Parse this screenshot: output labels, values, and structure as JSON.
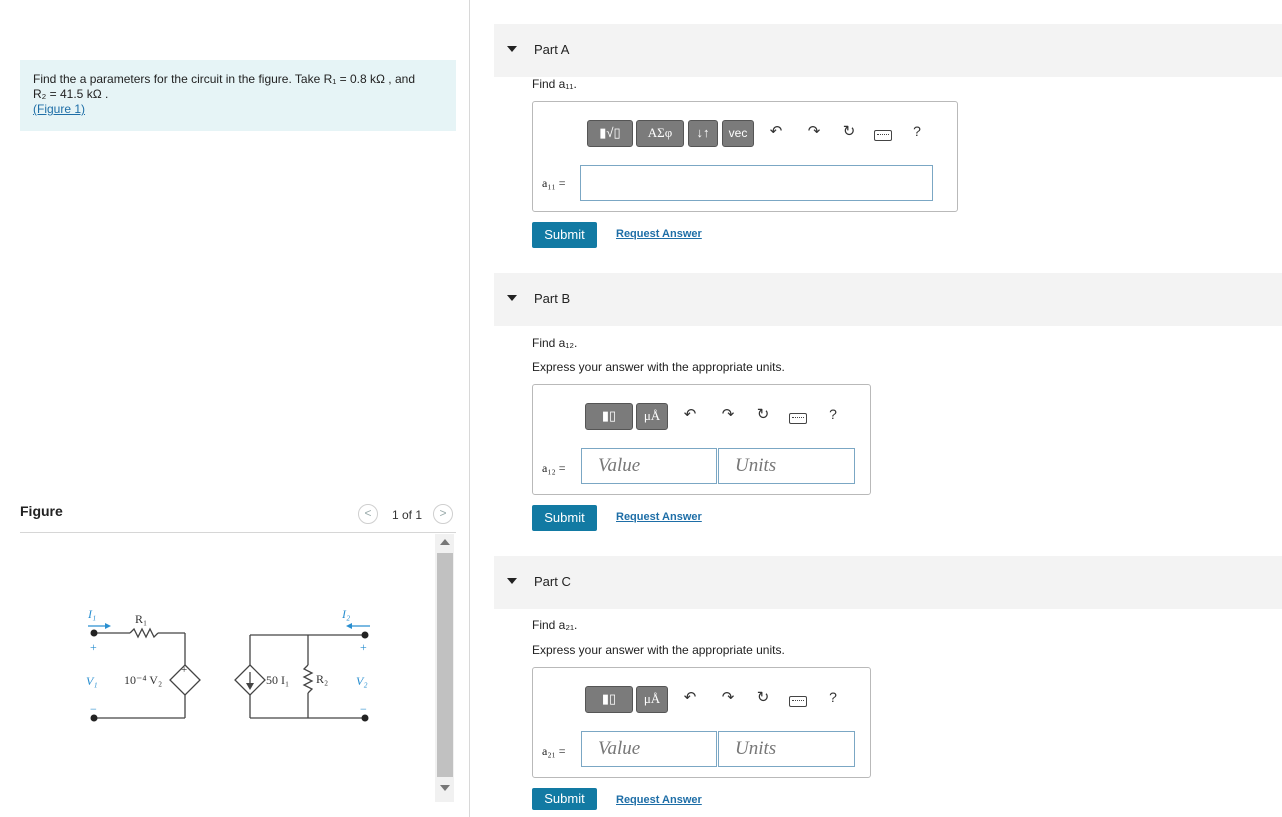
{
  "problem": {
    "line1": "Find the a parameters for the circuit in the figure. Take R₁ = 0.8 kΩ , and",
    "line2": "R₂ = 41.5 kΩ .",
    "figure_link": "(Figure 1)"
  },
  "figure": {
    "label": "Figure",
    "pager": "1 of 1",
    "circuit": {
      "i1": "I₁",
      "r1": "R₁",
      "i2": "I₂",
      "r2": "R₂",
      "v1": "V₁",
      "v2": "V₂",
      "dep_voltage": "10⁻⁴ V₂",
      "dep_current": "50 I₁",
      "plus": "+",
      "minus": "−"
    }
  },
  "parts": [
    {
      "title": "Part A",
      "find": "Find a₁₁.",
      "var": "a₁₁ =",
      "toolbar": [
        "ΑΣφ",
        "↓↑",
        "vec"
      ],
      "submit": "Submit",
      "request": "Request Answer",
      "help": "?"
    },
    {
      "title": "Part B",
      "find": "Find a₁₂.",
      "express": "Express your answer with the appropriate units.",
      "var": "a₁₂ =",
      "value_placeholder": "Value",
      "units_placeholder": "Units",
      "unit_btn": "μÅ",
      "submit": "Submit",
      "request": "Request Answer",
      "help": "?"
    },
    {
      "title": "Part C",
      "find": "Find a₂₁.",
      "express": "Express your answer with the appropriate units.",
      "var": "a₂₁ =",
      "value_placeholder": "Value",
      "units_placeholder": "Units",
      "unit_btn": "μÅ",
      "submit": "Submit",
      "request": "Request Answer",
      "help": "?"
    }
  ],
  "colors": {
    "accent": "#127aa3",
    "link": "#1e6ea7",
    "problem_bg": "#e6f4f6",
    "circuit_blue": "#2a8fd0"
  }
}
